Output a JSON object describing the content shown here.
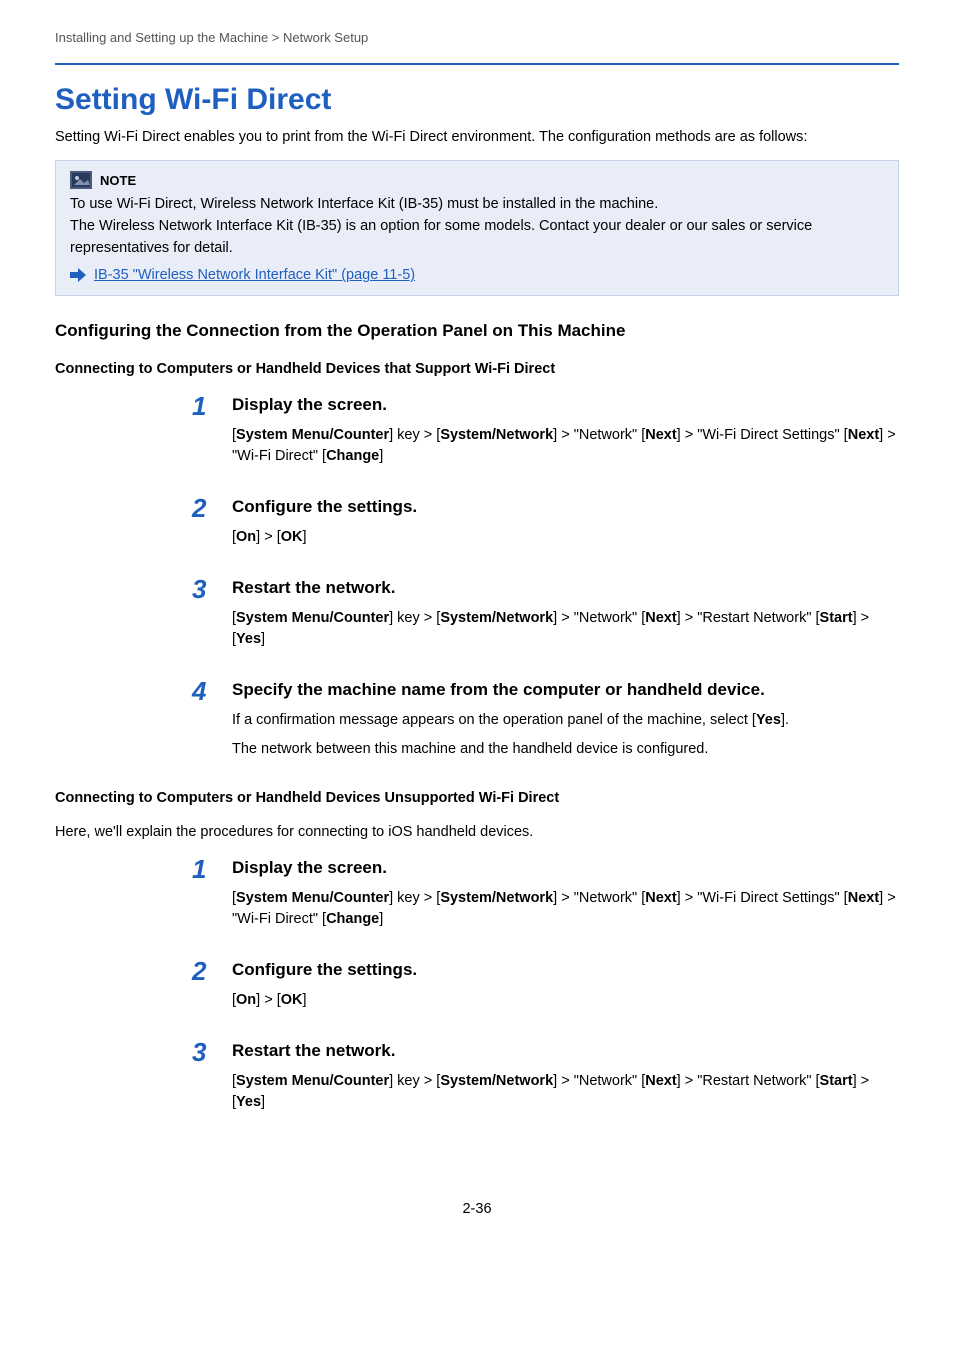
{
  "breadcrumb": "Installing and Setting up the Machine > Network Setup",
  "title": "Setting Wi-Fi Direct",
  "intro": "Setting Wi-Fi Direct enables you to print from the Wi-Fi Direct environment. The configuration methods are as follows:",
  "note": {
    "label": "NOTE",
    "line1": "To use Wi-Fi Direct, Wireless Network Interface Kit (IB-35) must be installed in the machine.",
    "line2": "The Wireless Network Interface Kit (IB-35) is an option for some models. Contact your dealer or our sales or service representatives for detail.",
    "link": "IB-35 \"Wireless Network Interface Kit\" (page 11-5)"
  },
  "section1": {
    "heading": "Configuring the Connection from the Operation Panel on This Machine",
    "subheading1": "Connecting to Computers or Handheld Devices that Support Wi-Fi Direct",
    "steps1": [
      {
        "num": "1",
        "title": "Display the screen.",
        "detail_html": "[<b>System Menu/Counter</b>] key > [<b>System/Network</b>] > \"Network\" [<b>Next</b>] > \"Wi-Fi Direct Settings\" [<b>Next</b>] > \"Wi-Fi Direct\" [<b>Change</b>]"
      },
      {
        "num": "2",
        "title": "Configure the settings.",
        "detail_html": "[<b>On</b>] > [<b>OK</b>]"
      },
      {
        "num": "3",
        "title": "Restart the network.",
        "detail_html": "[<b>System Menu/Counter</b>] key > [<b>System/Network</b>] > \"Network\" [<b>Next</b>] > \"Restart Network\" [<b>Start</b>] > [<b>Yes</b>]"
      },
      {
        "num": "4",
        "title": "Specify the machine name from the computer or handheld device.",
        "detail_html": "If a confirmation message appears on the operation panel of the machine, select [<b>Yes</b>].",
        "detail2": "The network between this machine and the handheld device is configured."
      }
    ],
    "subheading2": "Connecting to Computers or Handheld Devices Unsupported Wi-Fi Direct",
    "para2": "Here, we'll explain the procedures for connecting to iOS handheld devices.",
    "steps2": [
      {
        "num": "1",
        "title": "Display the screen.",
        "detail_html": "[<b>System Menu/Counter</b>] key > [<b>System/Network</b>] > \"Network\" [<b>Next</b>] > \"Wi-Fi Direct Settings\" [<b>Next</b>] > \"Wi-Fi Direct\" [<b>Change</b>]"
      },
      {
        "num": "2",
        "title": "Configure the settings.",
        "detail_html": "[<b>On</b>] > [<b>OK</b>]"
      },
      {
        "num": "3",
        "title": "Restart the network.",
        "detail_html": "[<b>System Menu/Counter</b>] key > [<b>System/Network</b>] > \"Network\" [<b>Next</b>] > \"Restart Network\" [<b>Start</b>] > [<b>Yes</b>]"
      }
    ]
  },
  "pagenum": "2-36"
}
